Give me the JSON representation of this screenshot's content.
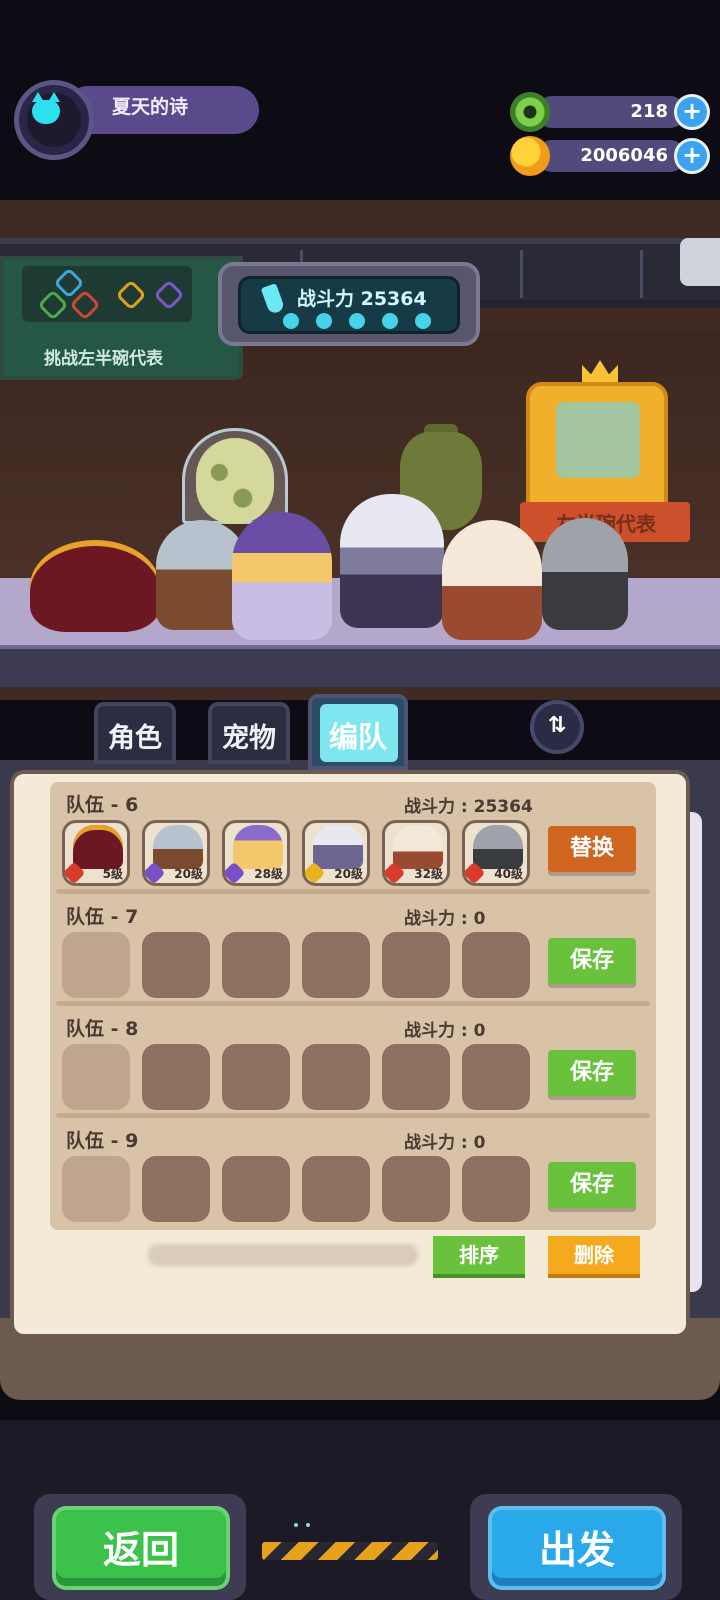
{
  "player": {
    "name": "夏天的诗",
    "avatar_icon": "cat-icon"
  },
  "currencies": [
    {
      "icon": "green-gem-icon",
      "value": "218",
      "add": "+"
    },
    {
      "icon": "gold-planet-coin-icon",
      "value": "2006046",
      "add": "+"
    }
  ],
  "stage": {
    "challenge_label": "挑战左半碗代表",
    "power_label": "战斗力 25364",
    "trophy_banner": "左半碗代表"
  },
  "tabs": [
    {
      "label": "角色",
      "active": false
    },
    {
      "label": "宠物",
      "active": false
    },
    {
      "label": "编队",
      "active": true
    }
  ],
  "swap_label": "⇅",
  "teams": [
    {
      "name": "队伍 - 6",
      "power": "战斗力 : 25364",
      "action": "替换",
      "members": [
        {
          "level": "5级",
          "badge_color": "#d93a2a"
        },
        {
          "level": "20级",
          "badge_color": "#7b4fc7"
        },
        {
          "level": "28级",
          "badge_color": "#7b4fc7"
        },
        {
          "level": "20级",
          "badge_color": "#e8b21c"
        },
        {
          "level": "32级",
          "badge_color": "#d93a2a"
        },
        {
          "level": "40级",
          "badge_color": "#d93a2a"
        }
      ]
    },
    {
      "name": "队伍 - 7",
      "power": "战斗力 : 0",
      "action": "保存"
    },
    {
      "name": "队伍 - 8",
      "power": "战斗力 : 0",
      "action": "保存"
    },
    {
      "name": "队伍 - 9",
      "power": "战斗力 : 0",
      "action": "保存"
    }
  ],
  "list_buttons": {
    "sort": "排序",
    "delete": "删除"
  },
  "bottom": {
    "back": "返回",
    "go": "出发"
  },
  "colors": {
    "accent_green": "#6ac23c",
    "accent_orange": "#d0651f",
    "accent_yellow": "#f4a91e",
    "go_blue": "#29a8ea"
  }
}
